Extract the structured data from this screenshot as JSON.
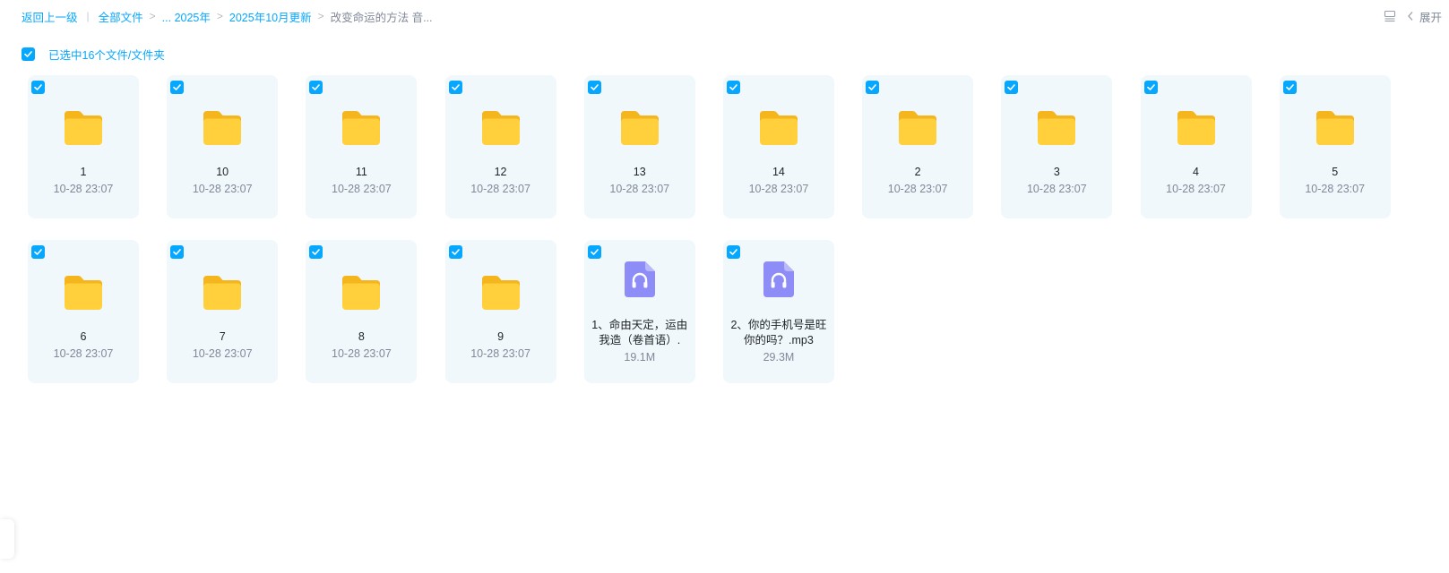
{
  "breadcrumb": {
    "back": "返回上一级",
    "all_files": "全部文件",
    "ellipsis": "... 2025年",
    "month": "2025年10月更新",
    "current": "改变命运的方法 音...",
    "sep": ">",
    "bar": "|"
  },
  "toolbar": {
    "expand_label": "展开"
  },
  "selection": {
    "text": "已选中16个文件/文件夹",
    "accent": "#06a7ff"
  },
  "items": [
    {
      "name": "1",
      "meta": "10-28 23:07",
      "type": "folder-icon"
    },
    {
      "name": "10",
      "meta": "10-28 23:07",
      "type": "folder-icon"
    },
    {
      "name": "11",
      "meta": "10-28 23:07",
      "type": "folder-icon"
    },
    {
      "name": "12",
      "meta": "10-28 23:07",
      "type": "folder-icon"
    },
    {
      "name": "13",
      "meta": "10-28 23:07",
      "type": "folder-icon"
    },
    {
      "name": "14",
      "meta": "10-28 23:07",
      "type": "folder-icon"
    },
    {
      "name": "2",
      "meta": "10-28 23:07",
      "type": "folder-icon"
    },
    {
      "name": "3",
      "meta": "10-28 23:07",
      "type": "folder-icon"
    },
    {
      "name": "4",
      "meta": "10-28 23:07",
      "type": "folder-icon"
    },
    {
      "name": "5",
      "meta": "10-28 23:07",
      "type": "folder-icon"
    },
    {
      "name": "6",
      "meta": "10-28 23:07",
      "type": "folder-icon"
    },
    {
      "name": "7",
      "meta": "10-28 23:07",
      "type": "folder-icon"
    },
    {
      "name": "8",
      "meta": "10-28 23:07",
      "type": "folder-icon"
    },
    {
      "name": "9",
      "meta": "10-28 23:07",
      "type": "folder-icon"
    },
    {
      "name": "1、命由天定，运由我造（卷首语）.",
      "meta": "19.1M",
      "type": "audio-file-icon"
    },
    {
      "name": "2、你的手机号是旺你的吗？.mp3",
      "meta": "29.3M",
      "type": "audio-file-icon"
    }
  ]
}
